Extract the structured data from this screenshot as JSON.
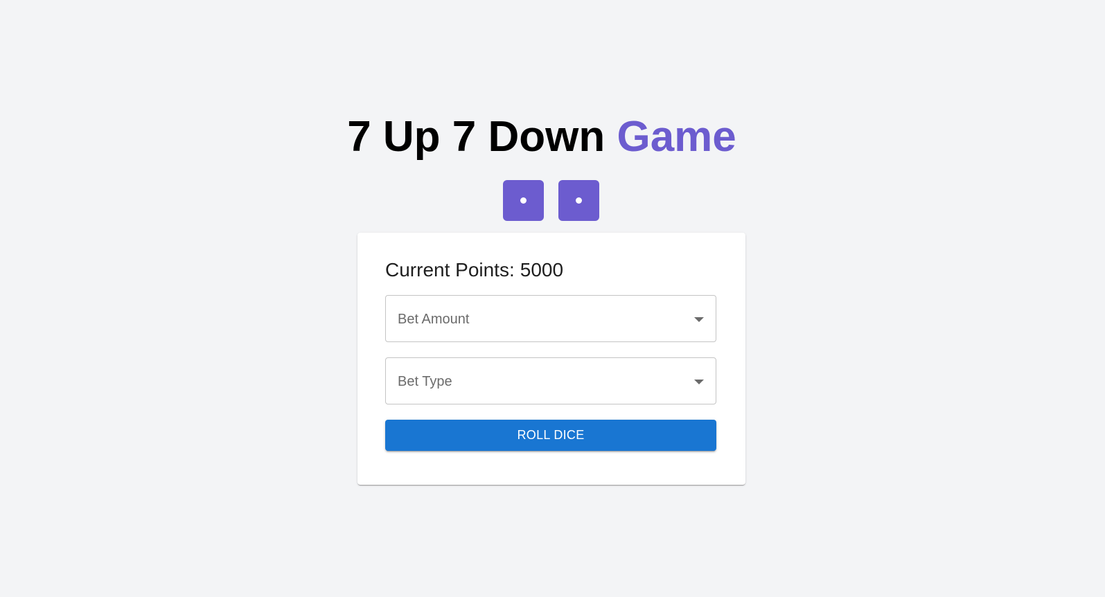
{
  "title": {
    "main": "7 Up 7 Down",
    "accent": "Game",
    "accent_color": "#6c5ccf"
  },
  "dice": [
    {
      "face": 1
    },
    {
      "face": 1
    }
  ],
  "points": {
    "label": "Current Points:",
    "value": "5000"
  },
  "bet_amount": {
    "label": "Bet Amount",
    "icon": "caret-down-icon"
  },
  "bet_type": {
    "label": "Bet Type",
    "icon": "caret-down-icon"
  },
  "roll_button": {
    "label": "ROLL DICE",
    "color": "#1976d2"
  }
}
